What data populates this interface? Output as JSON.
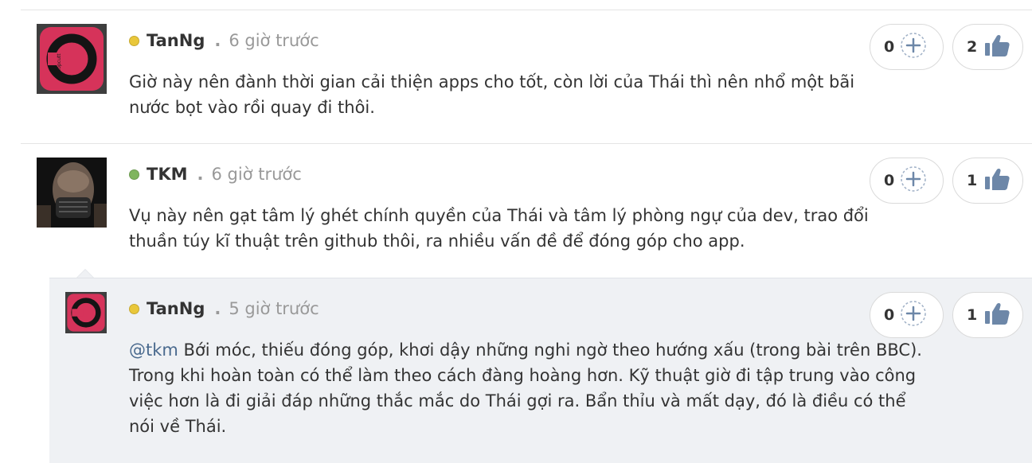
{
  "comments": [
    {
      "username": "TanNg",
      "status_color": "#e9c73a",
      "separator": ".",
      "time": "6 giờ trước",
      "text": "Giờ này nên đành thời gian cải thiện apps cho tốt, còn lời của Thái thì nên nhổ một bãi nước bọt vào rồi quay đi thôi.",
      "plus_count": "0",
      "like_count": "2"
    },
    {
      "username": "TKM",
      "status_color": "#7fb55e",
      "separator": ".",
      "time": "6 giờ trước",
      "text": "Vụ này nên gạt tâm lý ghét chính quyền của Thái và tâm lý phòng ngự của dev, trao đổi thuần túy kĩ thuật trên github thôi, ra nhiều vấn đề để đóng góp cho app.",
      "plus_count": "0",
      "like_count": "1"
    }
  ],
  "reply": {
    "username": "TanNg",
    "status_color": "#e9c73a",
    "separator": ".",
    "time": "5 giờ trước",
    "mention": "@tkm",
    "text": " Bới móc, thiếu đóng góp, khơi dậy những nghi ngờ theo hướng xấu (trong bài trên BBC). Trong khi hoàn toàn có thể làm theo cách đàng hoàng hơn. Kỹ thuật giờ đi tập trung vào công việc hơn là đi giải đáp những thắc mắc do Thái gợi ra. Bẩn thỉu và mất dạy, đó là điều có thể nói về Thái.",
    "plus_count": "0",
    "like_count": "1"
  },
  "icons": {
    "plus": "plus-circle-icon",
    "like": "thumbs-up-icon"
  },
  "colors": {
    "accent_blue": "#6d87a8",
    "avatar_red": "#d6335a",
    "reply_bg": "#eff1f4"
  }
}
